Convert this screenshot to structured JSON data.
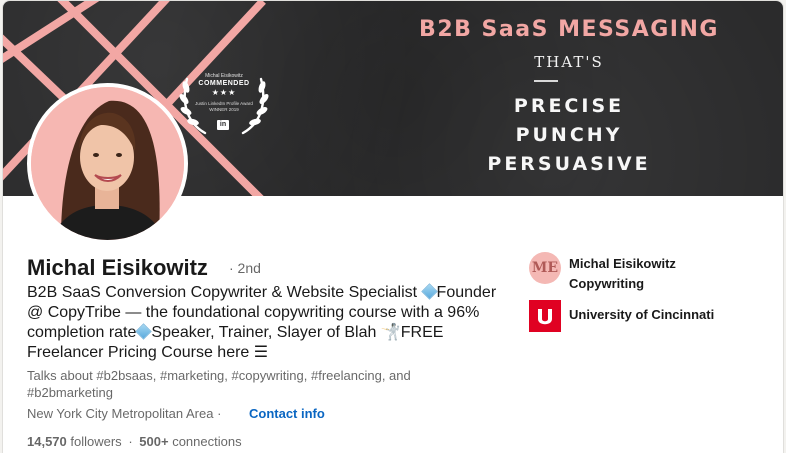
{
  "banner": {
    "title": "B2B SaaS MESSAGING",
    "thats": "THAT'S",
    "words": [
      "PRECISE",
      "PUNCHY",
      "PERSUASIVE"
    ],
    "award": {
      "top": "Michal Eisikowitz",
      "label": "COMMENDED",
      "stars": "★★★",
      "line1": "Justin LinkedIn Profile Award",
      "line2": "WINNER 2019",
      "logo": "in"
    }
  },
  "profile": {
    "name": "Michal Eisikowitz",
    "degree": "· 2nd",
    "headline_parts": [
      "B2B SaaS Conversion Copywriter & Website Specialist ",
      "Founder @ CopyTribe — the foundational copywriting course with a 96% completion rate",
      "Speaker, Trainer, Slayer of Blah ",
      "FREE Freelancer Pricing Course here "
    ],
    "talks_about": "Talks about #b2bsaas, #marketing, #copywriting, #freelancing, and #b2bmarketing",
    "location": "New York City Metropolitan Area",
    "location_sep": "·",
    "contact_info": "Contact info",
    "followers": "14,570",
    "followers_label": "followers",
    "connections": "500+",
    "connections_label": "connections"
  },
  "organizations": [
    {
      "name": "Michal Eisikowitz Copywriting",
      "logo_text": "ME"
    },
    {
      "name": "University of Cincinnati",
      "logo_text": "C"
    }
  ],
  "colors": {
    "banner_bg": "#2b2b2c",
    "accent_pink": "#f2a7a4",
    "link_blue": "#0a66c2",
    "uc_red": "#e00122"
  }
}
